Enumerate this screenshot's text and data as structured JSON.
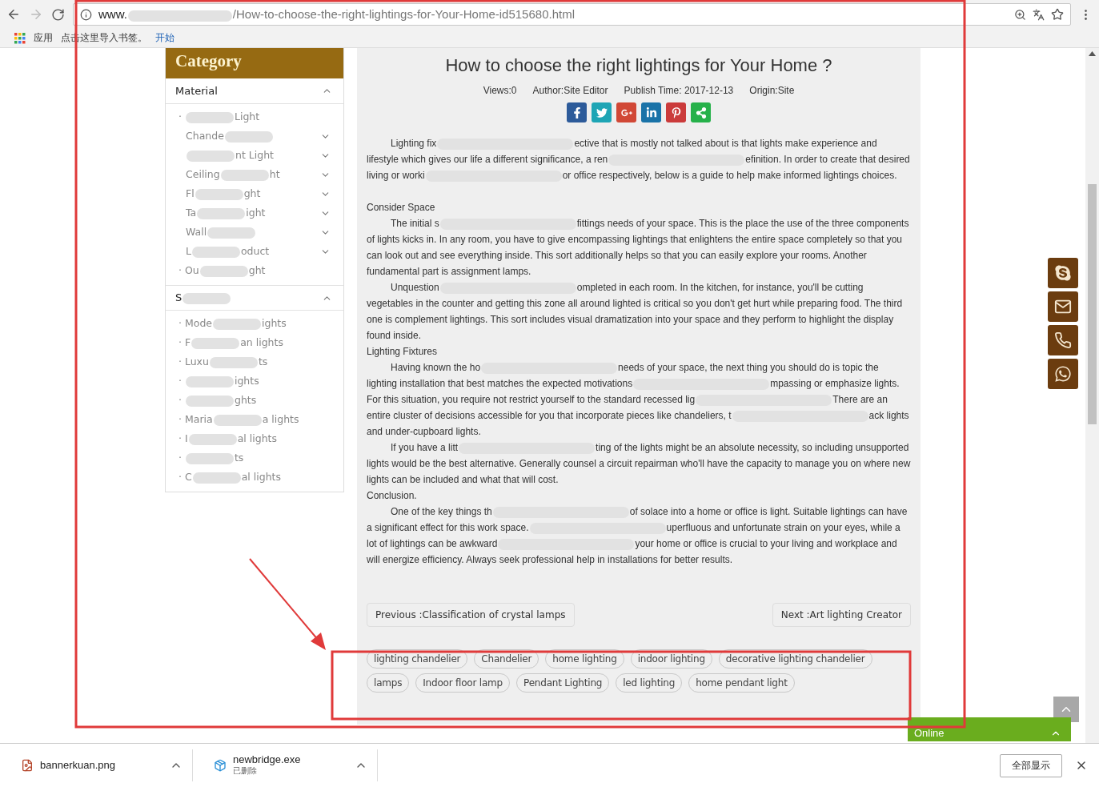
{
  "browser": {
    "url": [
      "www.",
      {
        "kind": "redaction"
      },
      "/How-to-choose-the-right-lightings-for-Your-Home-id515680.html"
    ]
  },
  "bookmarks_bar": {
    "apps": "应用",
    "hint": "点击这里导入书签。",
    "link": "开始"
  },
  "sidebar": {
    "title": "Category",
    "sections": [
      {
        "title": [
          "Material"
        ],
        "expanded": true,
        "items": [
          {
            "kind": "bullet",
            "marker": "·",
            "segments": [
              {
                "kind": "redaction"
              },
              "Light"
            ]
          },
          {
            "kind": "submenu",
            "expanded": false,
            "segments": [
              "Chande",
              {
                "kind": "redaction"
              }
            ]
          },
          {
            "kind": "submenu",
            "expanded": false,
            "segments": [
              {
                "kind": "redaction"
              },
              "nt Light"
            ]
          },
          {
            "kind": "submenu",
            "expanded": false,
            "segments": [
              "Ceiling",
              {
                "kind": "redaction"
              },
              "ht"
            ]
          },
          {
            "kind": "submenu",
            "expanded": false,
            "segments": [
              "Fl",
              {
                "kind": "redaction"
              },
              "ght"
            ]
          },
          {
            "kind": "submenu",
            "expanded": false,
            "segments": [
              "Ta",
              {
                "kind": "redaction"
              },
              "ight"
            ]
          },
          {
            "kind": "submenu",
            "expanded": false,
            "segments": [
              "Wall",
              {
                "kind": "redaction"
              }
            ]
          },
          {
            "kind": "submenu",
            "expanded": false,
            "segments": [
              "L",
              {
                "kind": "redaction"
              },
              "oduct"
            ]
          },
          {
            "kind": "bullet",
            "marker": "·",
            "segments": [
              "Ou",
              {
                "kind": "redaction"
              },
              "ght"
            ]
          }
        ]
      },
      {
        "title": [
          "S",
          {
            "kind": "redaction"
          }
        ],
        "expanded": true,
        "items": [
          {
            "kind": "bullet",
            "marker": "·",
            "segments": [
              "Mode",
              {
                "kind": "redaction"
              },
              "ights"
            ]
          },
          {
            "kind": "bullet",
            "marker": "·",
            "segments": [
              "F",
              {
                "kind": "redaction"
              },
              "an lights"
            ]
          },
          {
            "kind": "bullet",
            "marker": "·",
            "segments": [
              "Luxu",
              {
                "kind": "redaction"
              },
              "ts"
            ]
          },
          {
            "kind": "bullet",
            "marker": "·",
            "segments": [
              {
                "kind": "redaction"
              },
              "ights"
            ]
          },
          {
            "kind": "bullet",
            "marker": "·",
            "segments": [
              {
                "kind": "redaction"
              },
              "ghts"
            ]
          },
          {
            "kind": "bullet",
            "marker": "·",
            "segments": [
              "Maria",
              {
                "kind": "redaction"
              },
              "a lights"
            ]
          },
          {
            "kind": "bullet",
            "marker": "·",
            "segments": [
              "I",
              {
                "kind": "redaction"
              },
              "al lights"
            ]
          },
          {
            "kind": "bullet",
            "marker": "·",
            "segments": [
              {
                "kind": "redaction"
              },
              "ts"
            ]
          },
          {
            "kind": "bullet",
            "marker": "·",
            "segments": [
              "C",
              {
                "kind": "redaction"
              },
              "al lights"
            ]
          }
        ]
      }
    ]
  },
  "article": {
    "title": "How to choose the right lightings for Your Home ?",
    "meta": [
      "Views:0",
      "Author:Site Editor",
      "Publish Time: 2017-12-13",
      "Origin:Site"
    ],
    "share": [
      {
        "kind": "facebook",
        "color": "#2d5b9a"
      },
      {
        "kind": "twitter",
        "color": "#1ea5b5"
      },
      {
        "kind": "googleplus",
        "color": "#d14836"
      },
      {
        "kind": "linkedin",
        "color": "#1a73a8"
      },
      {
        "kind": "pinterest",
        "color": "#cb3b3b"
      },
      {
        "kind": "share",
        "color": "#26b14a"
      }
    ],
    "blocks": [
      {
        "kind": "paragraph",
        "segments": [
          "Lighting fix",
          {
            "kind": "redaction"
          },
          "ective that is mostly not talked about is that lights make experience and lifestyle which gives our life a different significance, a ren",
          {
            "kind": "redaction"
          },
          "efinition. In order to create that desired living or worki",
          {
            "kind": "redaction"
          },
          "or office respectively, below is a guide to help make informed lightings choices."
        ]
      },
      {
        "kind": "spacer"
      },
      {
        "kind": "heading",
        "segments": [
          "Consider Space"
        ]
      },
      {
        "kind": "paragraph",
        "segments": [
          "The initial s",
          {
            "kind": "redaction"
          },
          "fittings needs of your space. This is the place the use of the three components of lights kicks in. In any room, you have to give encompassing lightings that enlightens the entire space completely so that you can look out and see everything inside. This sort additionally helps so that you can easily explore your rooms. Another fundamental part is assignment lamps."
        ]
      },
      {
        "kind": "paragraph",
        "segments": [
          "Unquestion",
          {
            "kind": "redaction"
          },
          "ompleted in each room. In the kitchen, for instance, you'll be cutting vegetables in the counter and getting this zone all around lighted is critical so you don't get hurt while preparing food. The third one is complement lightings. This sort includes visual dramatization into your space and they perform to highlight the display found inside."
        ]
      },
      {
        "kind": "heading",
        "segments": [
          "Lighting Fixtures"
        ]
      },
      {
        "kind": "paragraph",
        "segments": [
          "Having known the ho",
          {
            "kind": "redaction"
          },
          "needs of your space, the next thing you should do is topic the lighting installation that best matches the expected motivations",
          {
            "kind": "redaction"
          },
          "mpassing or emphasize lights. For this situation, you require not restrict yourself to the standard recessed lig",
          {
            "kind": "redaction"
          },
          "There are an entire cluster of decisions accessible for you that incorporate pieces like chandeliers, t",
          {
            "kind": "redaction"
          },
          "ack lights and under-cupboard lights."
        ]
      },
      {
        "kind": "paragraph",
        "segments": [
          "If you have a litt",
          {
            "kind": "redaction"
          },
          "ting of the lights might be an absolute necessity, so including unsupported lights would be the best alternative. Generally counsel a circuit repairman who'll have the capacity to manage you on where new lights can be included and what that will cost."
        ]
      },
      {
        "kind": "heading",
        "segments": [
          "Conclusion."
        ]
      },
      {
        "kind": "paragraph",
        "segments": [
          "One of the key things th",
          {
            "kind": "redaction"
          },
          "of solace into a home or office is light. Suitable lightings can have a significant effect for this work space.",
          {
            "kind": "redaction"
          },
          "uperfluous and unfortunate strain on your eyes, while a lot of lightings can be awkward",
          {
            "kind": "redaction"
          },
          "your home or office is crucial to your living and workplace and will energize efficiency. Always seek professional help in installations for better results."
        ]
      }
    ],
    "previous": "Previous :Classification of crystal lamps",
    "next": "Next :Art lighting Creator",
    "tags": [
      "lighting chandelier",
      "Chandelier",
      "home lighting",
      "indoor lighting",
      "decorative lighting chandelier",
      "lamps",
      "Indoor floor lamp",
      "Pendant Lighting",
      "led lighting",
      "home pendant light"
    ]
  },
  "contact_buttons": [
    {
      "kind": "skype"
    },
    {
      "kind": "mail"
    },
    {
      "kind": "phone"
    },
    {
      "kind": "whatsapp"
    }
  ],
  "online_chat": {
    "label": "Online"
  },
  "downloads": [
    {
      "kind": "image",
      "name": "bannerkuan.png"
    },
    {
      "kind": "installer",
      "name": "newbridge.exe",
      "status": "已删除"
    }
  ],
  "show_all": "全部显示",
  "annotations": [
    {
      "kind": "frame"
    },
    {
      "kind": "frame"
    },
    {
      "kind": "arrow"
    }
  ]
}
